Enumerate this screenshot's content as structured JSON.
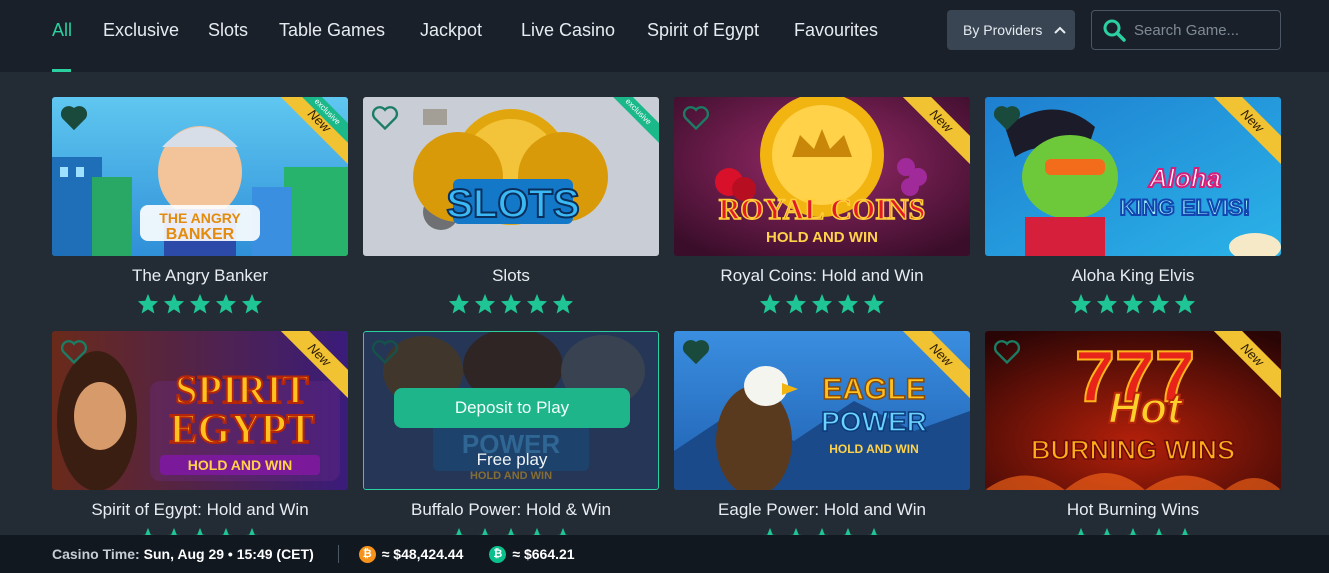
{
  "nav": {
    "tabs": [
      {
        "label": "All",
        "active": true
      },
      {
        "label": "Exclusive"
      },
      {
        "label": "Slots"
      },
      {
        "label": "Table Games"
      },
      {
        "label": "Jackpot"
      },
      {
        "label": "Live Casino"
      },
      {
        "label": "Spirit of Egypt"
      },
      {
        "label": "Favourites"
      }
    ],
    "providers_label": "By Providers",
    "search_placeholder": "Search Game..."
  },
  "games": [
    {
      "title": "The Angry Banker",
      "art_text": "THE ANGRY BANKER",
      "ribbon": "New",
      "tag": "exclusive",
      "rating": 5,
      "favorite": true
    },
    {
      "title": "Slots",
      "art_text": "SLOTS",
      "ribbon": "",
      "tag": "exclusive",
      "rating": 5,
      "favorite": false
    },
    {
      "title": "Royal Coins: Hold and Win",
      "art_text": "ROYAL COINS",
      "art_sub": "HOLD AND WIN",
      "ribbon": "New",
      "tag": "",
      "rating": 5,
      "favorite": false
    },
    {
      "title": "Aloha King Elvis",
      "art_text": "Aloha KING ELVIS!",
      "ribbon": "New",
      "tag": "",
      "rating": 5,
      "favorite": true
    },
    {
      "title": "Spirit of Egypt: Hold and Win",
      "art_text": "SPIRIT EGYPT",
      "art_sub": "HOLD AND WIN",
      "ribbon": "New",
      "tag": "",
      "rating": 5,
      "favorite": false
    },
    {
      "title": "Buffalo Power: Hold & Win",
      "art_text": "BUFFALO POWER",
      "art_sub": "HOLD AND WIN",
      "ribbon": "",
      "tag": "",
      "rating": 5,
      "favorite": false
    },
    {
      "title": "Eagle Power: Hold and Win",
      "art_text": "EAGLE POWER",
      "art_sub": "HOLD AND WIN",
      "ribbon": "New",
      "tag": "",
      "rating": 5,
      "favorite": true
    },
    {
      "title": "Hot Burning Wins",
      "art_text": "777 Hot",
      "art_sub": "BURNING WINS",
      "ribbon": "New",
      "tag": "",
      "rating": 5,
      "favorite": false
    }
  ],
  "hover": {
    "deposit_label": "Deposit to Play",
    "free_play_label": "Free play"
  },
  "footer": {
    "casino_time_label": "Casino Time:",
    "casino_time_value": "Sun, Aug 29 • 15:49 (CET)",
    "btc_price": "≈ $48,424.44",
    "bch_price": "≈ $664.21"
  },
  "colors": {
    "accent": "#2bd0a0",
    "star": "#1fc594",
    "ribbon": "#f1c232",
    "btc": "#f7931a",
    "bch": "#0ac18e"
  }
}
